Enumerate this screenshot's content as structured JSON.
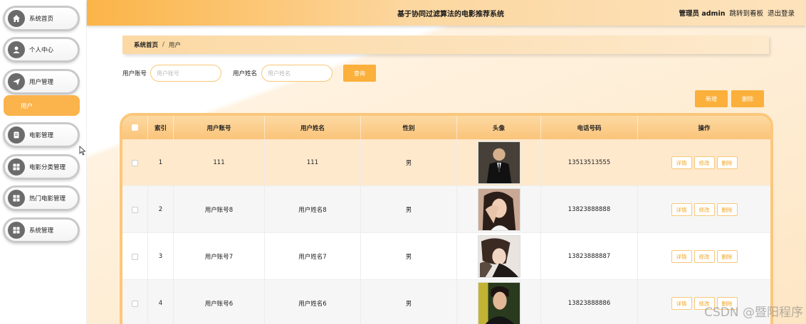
{
  "sidebar": {
    "items": [
      {
        "label": "系统首页",
        "icon": "home-icon"
      },
      {
        "label": "个人中心",
        "icon": "user-icon"
      },
      {
        "label": "用户管理",
        "icon": "send-icon"
      },
      {
        "label": "电影管理",
        "icon": "document-icon"
      },
      {
        "label": "电影分类管理",
        "icon": "grid-icon"
      },
      {
        "label": "热门电影管理",
        "icon": "grid-icon"
      },
      {
        "label": "系统管理",
        "icon": "grid-icon"
      }
    ],
    "sub_item": "用户"
  },
  "header": {
    "title": "基于协同过滤算法的电影推荐系统",
    "user": "管理员 admin",
    "dashboard_link": "跳转到看板",
    "logout_link": "退出登录"
  },
  "breadcrumb": {
    "home": "系统首页",
    "separator": "/",
    "current": "用户"
  },
  "search": {
    "account_label": "用户账号",
    "account_placeholder": "用户账号",
    "name_label": "用户姓名",
    "name_placeholder": "用户姓名",
    "query_button": "查询"
  },
  "actions": {
    "add_button": "新增",
    "delete_button": "删除"
  },
  "table": {
    "headers": [
      "索引",
      "用户账号",
      "用户姓名",
      "性别",
      "头像",
      "电话号码",
      "操作"
    ],
    "rows": [
      {
        "index": "1",
        "account": "111",
        "name": "111",
        "gender": "男",
        "phone": "13513513555"
      },
      {
        "index": "2",
        "account": "用户账号8",
        "name": "用户姓名8",
        "gender": "男",
        "phone": "13823888888"
      },
      {
        "index": "3",
        "account": "用户账号7",
        "name": "用户姓名7",
        "gender": "男",
        "phone": "13823888887"
      },
      {
        "index": "4",
        "account": "用户账号6",
        "name": "用户姓名6",
        "gender": "男",
        "phone": "13823888886"
      }
    ],
    "row_ops": {
      "detail": "详情",
      "edit": "修改",
      "delete": "删除"
    }
  },
  "watermark": "CSDN @暨阳程序",
  "colors": {
    "accent": "#fbb03b",
    "header_gradient_start": "#fbb447",
    "row_highlight": "#ffe9cc"
  }
}
